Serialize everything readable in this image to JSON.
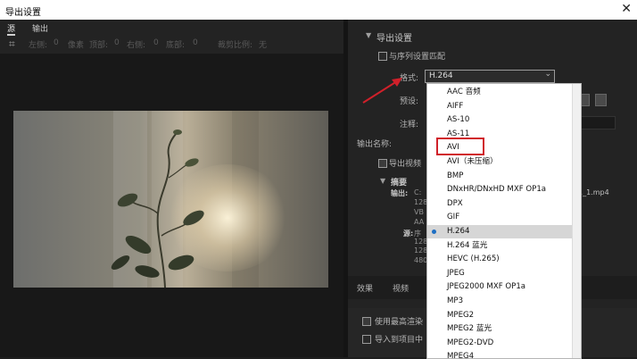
{
  "window": {
    "title": "导出设置",
    "close_glyph": "✕"
  },
  "left_tabs": [
    {
      "label": "源"
    },
    {
      "label": "输出"
    }
  ],
  "crop": {
    "icon": "crop-icon",
    "items": [
      "左侧:",
      "0",
      "像素",
      "顶部:",
      "0",
      "右侧:",
      "0",
      "底部:",
      "0",
      "裁剪比例:",
      "无"
    ]
  },
  "export_settings": {
    "header": "导出设置",
    "match_sequence_label": "与序列设置匹配",
    "format_label": "格式:",
    "format_value": "H.264",
    "preset_label": "预设:",
    "comments_label": "注释:",
    "output_name_label": "输出名称:",
    "filename_suffix": "1_1.mp4",
    "export_video_label": "导出视频",
    "summary_label": "摘要",
    "output_key": "输出:",
    "output_lines": [
      "C:",
      "128",
      "VB",
      "AA",
      "128"
    ],
    "source_key": "源:",
    "source_lines": [
      "序",
      "128",
      "480"
    ]
  },
  "bottom_tabs": [
    {
      "label": "效果"
    },
    {
      "label": "视频"
    }
  ],
  "lower_options": {
    "max_render_label": "使用最高渲染",
    "import_project_label": "导入到项目中"
  },
  "format_dropdown": {
    "options": [
      "AAC 音频",
      "AIFF",
      "AS-10",
      "AS-11",
      "AVI",
      "AVI（未压缩）",
      "BMP",
      "DNxHR/DNxHD MXF OP1a",
      "DPX",
      "GIF",
      "H.264",
      "H.264 蓝光",
      "HEVC (H.265)",
      "JPEG",
      "JPEG2000 MXF OP1a",
      "MP3",
      "MPEG2",
      "MPEG2 蓝光",
      "MPEG2-DVD",
      "MPEG4"
    ],
    "selected": "H.264",
    "highlighted": "AVI"
  },
  "colors": {
    "panel_bg": "#232323",
    "dropdown_bg": "#ffffff",
    "selected_bullet": "#1e6fc4",
    "annotation_red": "#d0202a"
  }
}
